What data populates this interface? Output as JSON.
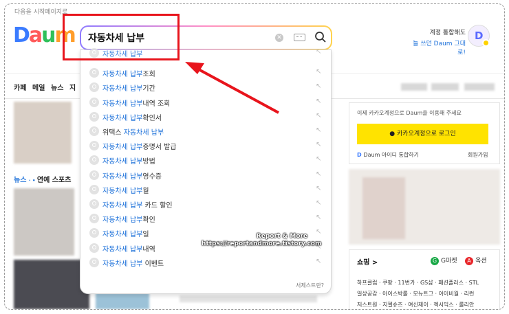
{
  "top_note": "다음을 시작페이지로",
  "logo": {
    "letters": [
      "D",
      "a",
      "u",
      "m"
    ]
  },
  "search": {
    "value": "자동차세 납부"
  },
  "account": {
    "line1": "계정 통합해도",
    "line2": "늘 쓰던 Daum 그대로!",
    "avatar_letter": "D"
  },
  "nav": {
    "items": [
      "카페",
      "메일",
      "뉴스",
      "지"
    ]
  },
  "suggestions": [
    {
      "pre": "",
      "hl": "자동차세 납부",
      "post": ""
    },
    {
      "pre": "",
      "hl": "자동차세 납부",
      "post": "조회"
    },
    {
      "pre": "",
      "hl": "자동차세 납부",
      "post": "기간"
    },
    {
      "pre": "",
      "hl": "자동차세 납부",
      "post": "내역 조회"
    },
    {
      "pre": "",
      "hl": "자동차세 납부",
      "post": "확인서"
    },
    {
      "pre": "위택스 ",
      "hl": "자동차세 납부",
      "post": ""
    },
    {
      "pre": "",
      "hl": "자동차세 납부",
      "post": "증명서 발급"
    },
    {
      "pre": "",
      "hl": "자동차세 납부",
      "post": "방법"
    },
    {
      "pre": "",
      "hl": "자동차세 납부",
      "post": "영수증"
    },
    {
      "pre": "",
      "hl": "자동차세 납부",
      "post": "월"
    },
    {
      "pre": "",
      "hl": "자동차세 납부",
      "post": " 카드 할인"
    },
    {
      "pre": "",
      "hl": "자동차세 납부",
      "post": "확인"
    },
    {
      "pre": "",
      "hl": "자동차세 납부",
      "post": "일"
    },
    {
      "pre": "",
      "hl": "자동차세 납부",
      "post": "내역"
    },
    {
      "pre": "",
      "hl": "자동차세 납부",
      "post": " 이벤트"
    }
  ],
  "dropdown_footer": "서제스트란?",
  "login_panel": {
    "text": "이제 카카오계정으로 Daum을 이용해 주세요",
    "button": "카카오계정으로 로그인",
    "daum_link": "Daum 아이디 통합하기",
    "join": "회원가입"
  },
  "news_tabs": [
    "뉴스",
    "연예",
    "스포츠"
  ],
  "shopping": {
    "title": "쇼핑 >",
    "gmarket": "G마켓",
    "auction": "옥션",
    "lines": [
      "하프클럽 · 쿠팡 · 11번가 · GS샵 · 패션플러스 · STL",
      "일상공감 · 아이스박룰 · 모뉴트그 · 아이비월 · 리런",
      "저스트원 · 지젤슈즈 · 여신제이 · 젝시믹스 · 룰리안"
    ]
  },
  "watermark": {
    "line1": "Report & More",
    "line2": "https://reportandmore.tistory.com"
  },
  "colors": {
    "highlight": "#1a6fd9",
    "annotation_red": "#e8141c",
    "kakao_yellow": "#ffe300"
  }
}
